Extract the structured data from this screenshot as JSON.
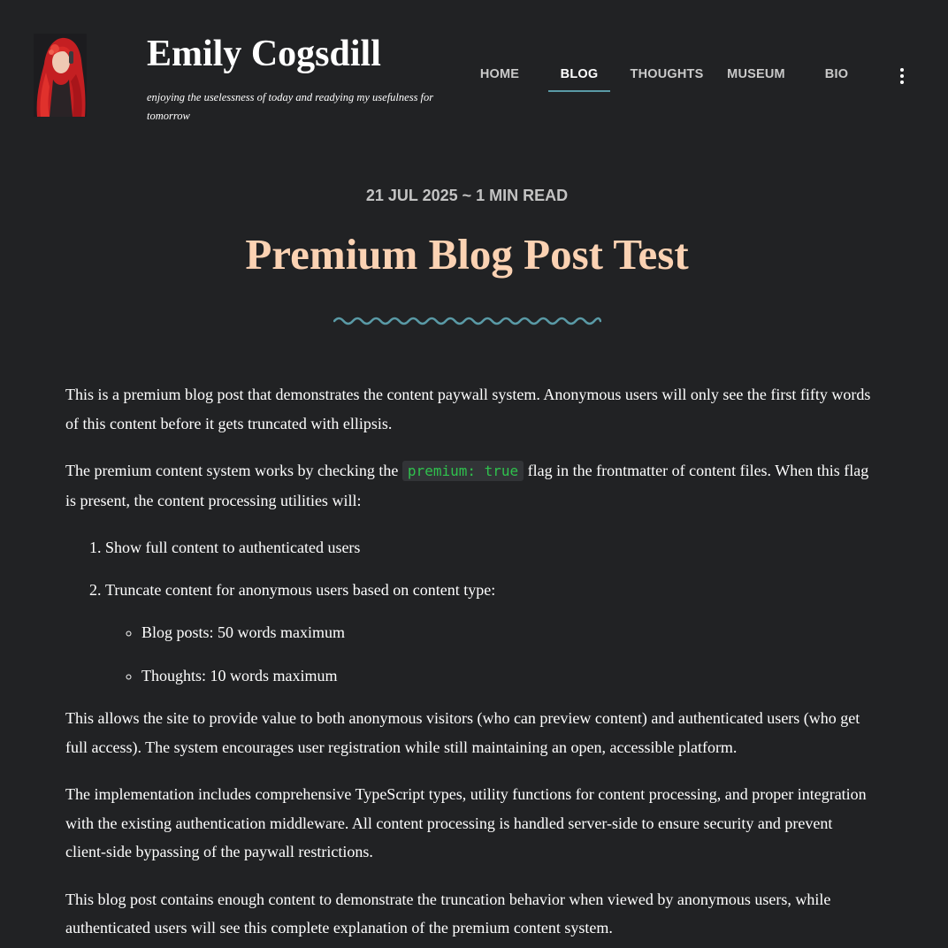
{
  "site": {
    "title": "Emily Cogsdill",
    "tagline": "enjoying the uselessness of today and readying my usefulness for tomorrow",
    "avatar_icon": "profile-photo"
  },
  "nav": {
    "items": [
      {
        "label": "HOME",
        "active": false
      },
      {
        "label": "BLOG",
        "active": true
      },
      {
        "label": "THOUGHTS",
        "active": false
      },
      {
        "label": "MUSEUM",
        "active": false
      },
      {
        "label": "BIO",
        "active": false
      }
    ],
    "more_icon": "vertical-ellipsis-icon"
  },
  "post": {
    "meta": "21 JUL 2025 ~ 1 MIN READ",
    "title": "Premium Blog Post Test",
    "paragraph_1": "This is a premium blog post that demonstrates the content paywall system. Anonymous users will only see the first fifty words of this content before it gets truncated with ellipsis.",
    "paragraph_2_before": "The premium content system works by checking the ",
    "paragraph_2_code": "premium: true",
    "paragraph_2_after": " flag in the frontmatter of content files. When this flag is present, the content processing utilities will:",
    "list": [
      "Show full content to authenticated users",
      "Truncate content for anonymous users based on content type:"
    ],
    "sublist": [
      "Blog posts: 50 words maximum",
      "Thoughts: 10 words maximum"
    ],
    "paragraph_3": "This allows the site to provide value to both anonymous visitors (who can preview content) and authenticated users (who get full access). The system encourages user registration while still maintaining an open, accessible platform.",
    "paragraph_4": "The implementation includes comprehensive TypeScript types, utility functions for content processing, and proper integration with the existing authentication middleware. All content processing is handled server-side to ensure security and prevent client-side bypassing of the paywall restrictions.",
    "paragraph_5": "This blog post contains enough content to demonstrate the truncation behavior when viewed by anonymous users, while authenticated users will see this complete explanation of the premium content system."
  },
  "colors": {
    "background": "#212224",
    "title_accent": "#fbd2b3",
    "nav_underline": "#5a9aa6",
    "code_text": "#2fc14d",
    "code_background": "#323437"
  }
}
